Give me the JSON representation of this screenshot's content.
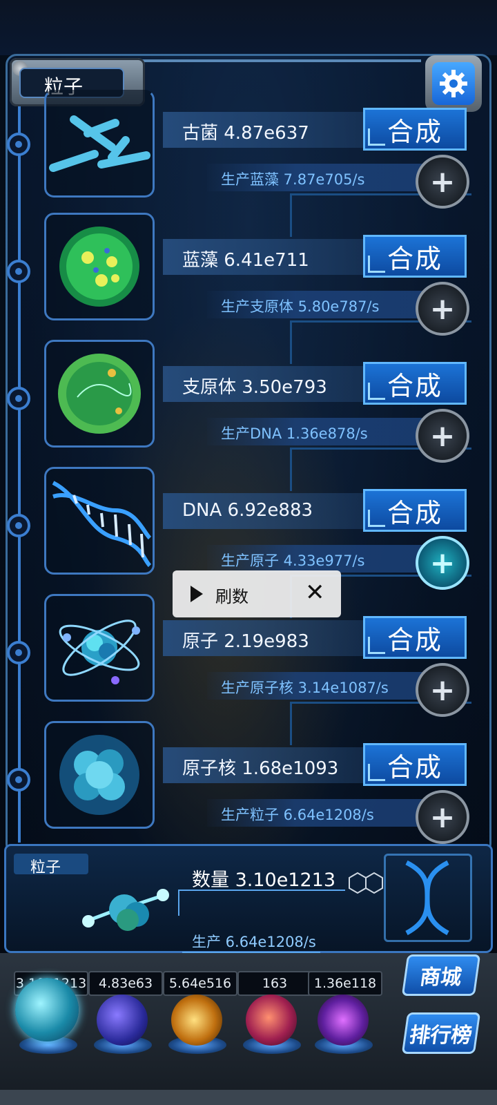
{
  "header": {
    "title": "粒子",
    "settings_icon": "gear-icon"
  },
  "rows": [
    {
      "name": "古菌 4.87e637",
      "production": "生产蓝藻 7.87e705/s",
      "synth_label": "合成",
      "icon": "archaea-icon",
      "plus_active": false
    },
    {
      "name": "蓝藻 6.41e711",
      "production": "生产支原体 5.80e787/s",
      "synth_label": "合成",
      "icon": "cyanobacteria-icon",
      "plus_active": false
    },
    {
      "name": "支原体 3.50e793",
      "production": "生产DNA 1.36e878/s",
      "synth_label": "合成",
      "icon": "mycoplasma-icon",
      "plus_active": false
    },
    {
      "name": "DNA 6.92e883",
      "production": "生产原子 4.33e977/s",
      "synth_label": "合成",
      "icon": "dna-icon",
      "plus_active": true
    },
    {
      "name": "原子 2.19e983",
      "production": "生产原子核 3.14e1087/s",
      "synth_label": "合成",
      "icon": "atom-icon",
      "plus_active": false
    },
    {
      "name": "原子核 1.68e1093",
      "production": "生产粒子 6.64e1208/s",
      "synth_label": "合成",
      "icon": "nucleus-icon",
      "plus_active": false
    }
  ],
  "popup": {
    "label": "刷数",
    "play_icon": "play-icon",
    "close_icon": "close-icon"
  },
  "particle_panel": {
    "tag": "粒子",
    "count": "数量 3.10e1213",
    "rate": "生产 6.64e1208/s"
  },
  "resources": [
    "3.10e1213",
    "4.83e63",
    "5.64e516",
    "163",
    "1.36e118"
  ],
  "side_buttons": {
    "shop": "商城",
    "leaderboard": "排行榜"
  },
  "colors": {
    "accent": "#1c73d6",
    "production_text": "#7fc2ff",
    "frame": "#3a6c9c"
  }
}
